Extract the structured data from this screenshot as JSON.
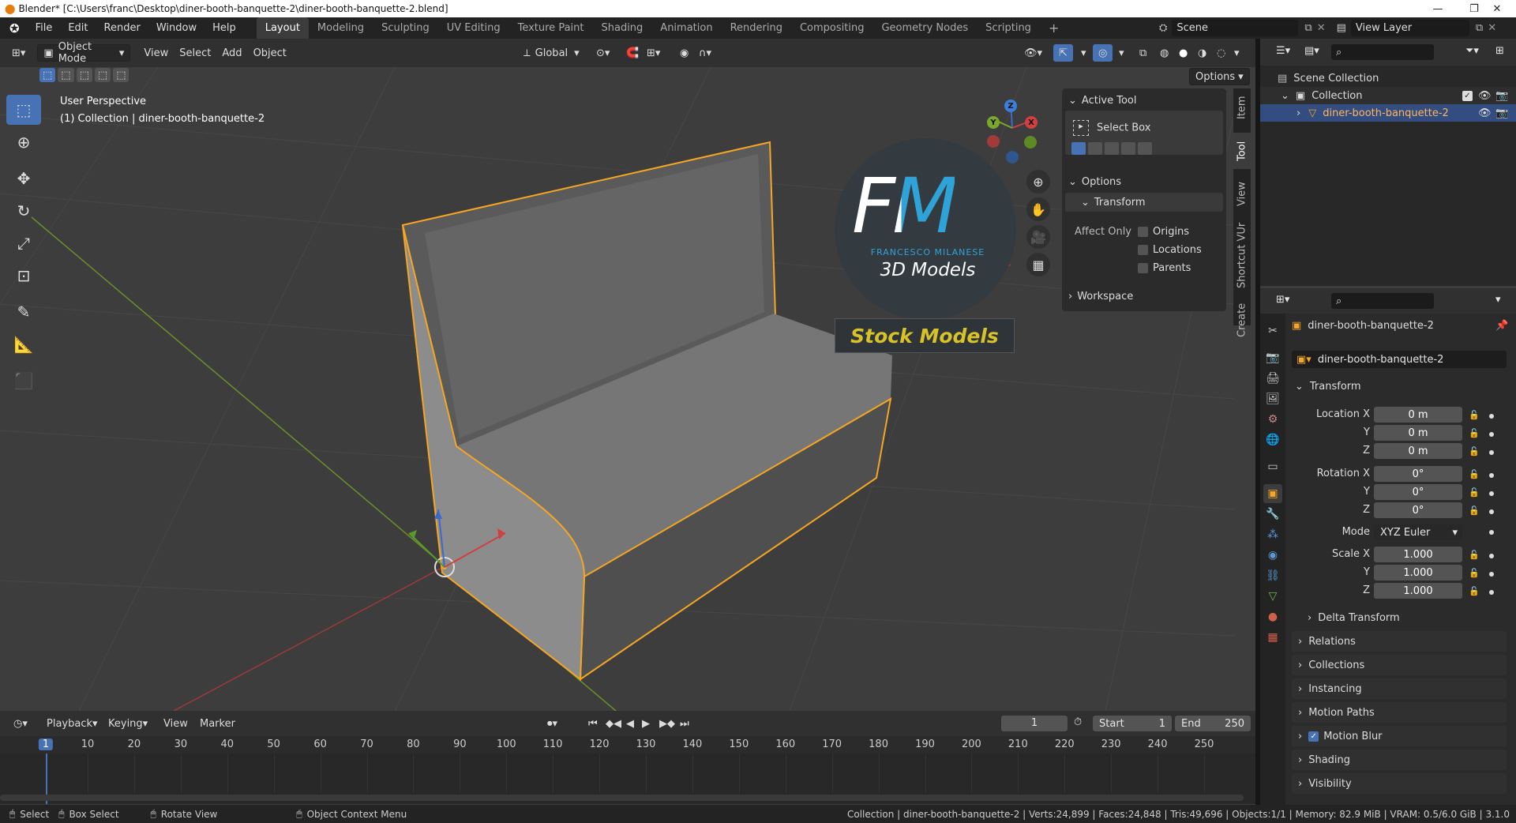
{
  "window": {
    "title": "Blender* [C:\\Users\\franc\\Desktop\\diner-booth-banquette-2\\diner-booth-banquette-2.blend]",
    "minimize": "—",
    "maximize": "❐",
    "close": "✕"
  },
  "menu": [
    "File",
    "Edit",
    "Render",
    "Window",
    "Help"
  ],
  "workspaces": [
    "Layout",
    "Modeling",
    "Sculpting",
    "UV Editing",
    "Texture Paint",
    "Shading",
    "Animation",
    "Rendering",
    "Compositing",
    "Geometry Nodes",
    "Scripting"
  ],
  "workspace_add": "+",
  "scene": {
    "name": "Scene",
    "view_layer": "View Layer"
  },
  "viewport_header": {
    "mode": "Object Mode",
    "menus": [
      "View",
      "Select",
      "Add",
      "Object"
    ],
    "transform_orientation": "Global",
    "options": "Options"
  },
  "viewport": {
    "perspective": "User Perspective",
    "collection_info": "(1) Collection | diner-booth-banquette-2"
  },
  "watermark": {
    "logo": "FM",
    "author": "FRANCESCO MILANESE",
    "tagline": "3D Models",
    "banner": "Stock Models"
  },
  "gizmo": {
    "z": "Z",
    "y": "Y",
    "x": "X"
  },
  "npanel": {
    "active_tool_title": "Active Tool",
    "tool_name": "Select Box",
    "options_title": "Options",
    "transform_title": "Transform",
    "affect_only": "Affect Only",
    "checks": [
      "Origins",
      "Locations",
      "Parents"
    ],
    "workspace_title": "Workspace",
    "tabs": [
      "Item",
      "Tool",
      "View",
      "Shortcut VUr",
      "Create"
    ]
  },
  "outliner": {
    "scene_collection": "Scene Collection",
    "collection": "Collection",
    "object": "diner-booth-banquette-2"
  },
  "properties": {
    "object_name": "diner-booth-banquette-2",
    "object_field": "diner-booth-banquette-2",
    "transform_title": "Transform",
    "location_label": "Location X",
    "rotation_label": "Rotation X",
    "scale_label": "Scale X",
    "y_label": "Y",
    "z_label": "Z",
    "mode_label": "Mode",
    "mode_value": "XYZ Euler",
    "location": [
      "0 m",
      "0 m",
      "0 m"
    ],
    "rotation": [
      "0°",
      "0°",
      "0°"
    ],
    "scale": [
      "1.000",
      "1.000",
      "1.000"
    ],
    "delta_transform": "Delta Transform",
    "sections": [
      "Relations",
      "Collections",
      "Instancing",
      "Motion Paths",
      "Motion Blur",
      "Shading",
      "Visibility"
    ]
  },
  "timeline": {
    "menus": [
      "Playback",
      "Keying",
      "View",
      "Marker"
    ],
    "current_frame": "1",
    "start_label": "Start",
    "start": "1",
    "end_label": "End",
    "end": "250",
    "ticks": [
      "1",
      "10",
      "20",
      "30",
      "40",
      "50",
      "60",
      "70",
      "80",
      "90",
      "100",
      "110",
      "120",
      "130",
      "140",
      "150",
      "160",
      "170",
      "180",
      "190",
      "200",
      "210",
      "220",
      "230",
      "240",
      "250"
    ]
  },
  "statusbar": {
    "select": "Select",
    "box_select": "Box Select",
    "rotate_view": "Rotate View",
    "context_menu": "Object Context Menu",
    "stats": "Collection | diner-booth-banquette-2 | Verts:24,899 | Faces:24,848 | Tris:49,696 | Objects:1/1 | Memory: 82.9 MiB | VRAM: 0.5/6.0 GiB | 3.1.0"
  },
  "colors": {
    "selection": "#f5a623",
    "accent": "#4772b3",
    "logo_white": "#ffffff",
    "logo_blue": "#2fa3d8",
    "banner_text": "#d8c22a"
  }
}
